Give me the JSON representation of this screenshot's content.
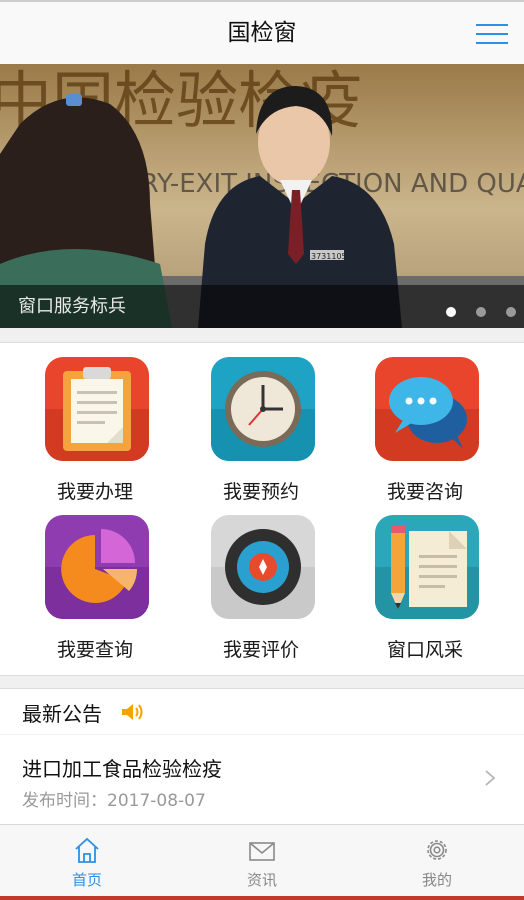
{
  "header": {
    "title": "国检窗",
    "menu_icon": "hamburger-menu-icon"
  },
  "banner": {
    "caption": "窗口服务标兵",
    "slide_count": 3,
    "active_slide": 1,
    "sign_text_zh": "中国检验检疫",
    "sign_text_en": "CHINA ENTRY-EXIT INSPECTION AND QUARANTINE",
    "badge_text": "3731105"
  },
  "services": [
    {
      "label": "我要办理",
      "icon": "clipboard-icon",
      "color": "#e8452c"
    },
    {
      "label": "我要预约",
      "icon": "clock-icon",
      "color": "#1fa3c4"
    },
    {
      "label": "我要咨询",
      "icon": "chat-bubbles-icon",
      "color": "#e8452c"
    },
    {
      "label": "我要查询",
      "icon": "pie-chart-icon",
      "color": "#8e3cb0"
    },
    {
      "label": "我要评价",
      "icon": "target-icon",
      "color": "#d7d7d7"
    },
    {
      "label": "窗口风采",
      "icon": "document-pencil-icon",
      "color": "#2aa7b8"
    }
  ],
  "notice": {
    "heading": "最新公告",
    "items": [
      {
        "title": "进口加工食品检验检疫",
        "date_label": "发布时间：2017-08-07"
      }
    ]
  },
  "tabs": [
    {
      "label": "首页",
      "icon": "home-icon",
      "active": true
    },
    {
      "label": "资讯",
      "icon": "envelope-icon",
      "active": false
    },
    {
      "label": "我的",
      "icon": "gear-icon",
      "active": false
    }
  ],
  "colors": {
    "accent": "#2f8fe0",
    "bottom_strip": "#c0392b"
  }
}
